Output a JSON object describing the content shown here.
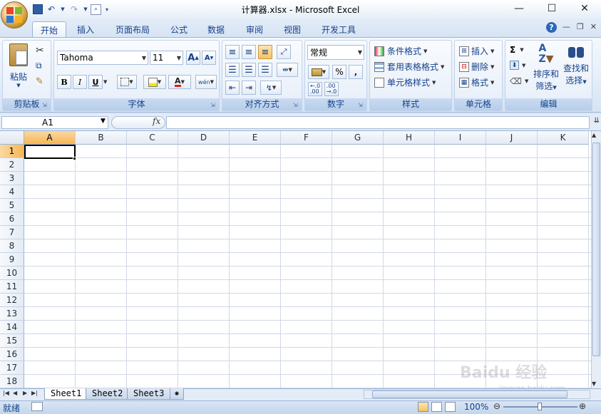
{
  "window": {
    "title": "计算器.xlsx - Microsoft Excel",
    "minimize": "—",
    "maximize": "☐",
    "close": "✕"
  },
  "quick_access": [
    {
      "icon": "save-icon",
      "glyph": "💾"
    },
    {
      "icon": "undo-icon",
      "glyph": "↶"
    },
    {
      "icon": "redo-icon",
      "glyph": "↷"
    },
    {
      "icon": "print-preview-icon",
      "glyph": "🔍"
    }
  ],
  "tabs": [
    "开始",
    "插入",
    "页面布局",
    "公式",
    "数据",
    "审阅",
    "视图",
    "开发工具"
  ],
  "active_tab": "开始",
  "ribbon": {
    "clipboard": {
      "label": "剪贴板",
      "paste": "粘贴"
    },
    "font": {
      "label": "字体",
      "name": "Tahoma",
      "size": "11",
      "bold": "B",
      "italic": "I",
      "underline": "U",
      "grow": "A",
      "shrink": "A",
      "phonetic": "wén"
    },
    "alignment": {
      "label": "对齐方式"
    },
    "number": {
      "label": "数字",
      "format": "常规",
      "percent": "%",
      "comma": ","
    },
    "styles": {
      "label": "样式",
      "conditional": "条件格式",
      "table": "套用表格格式",
      "cell_styles": "单元格样式"
    },
    "cells": {
      "label": "单元格",
      "insert": "插入",
      "delete": "删除",
      "format": "格式"
    },
    "editing": {
      "label": "编辑",
      "sigma": "Σ",
      "sort": "排序和",
      "sort2": "筛选",
      "find": "查找和",
      "find2": "选择"
    }
  },
  "formula_bar": {
    "name_box": "A1",
    "fx": "fx",
    "value": ""
  },
  "grid": {
    "columns": [
      "A",
      "B",
      "C",
      "D",
      "E",
      "F",
      "G",
      "H",
      "I",
      "J",
      "K"
    ],
    "rows": [
      "1",
      "2",
      "3",
      "4",
      "5",
      "6",
      "7",
      "8",
      "9",
      "10",
      "11",
      "12",
      "13",
      "14",
      "15",
      "16",
      "17",
      "18"
    ],
    "active_cell": "A1"
  },
  "sheets": [
    "Sheet1",
    "Sheet2",
    "Sheet3"
  ],
  "active_sheet": "Sheet1",
  "status": {
    "text": "就绪",
    "zoom": "100%"
  },
  "watermark": {
    "text": "Baidu 经验",
    "sub": "jingyan.baidu.com"
  },
  "colors": {
    "accent": "#15428b",
    "selected_header": "#f6b654",
    "grid_line": "#d0d7e5"
  }
}
